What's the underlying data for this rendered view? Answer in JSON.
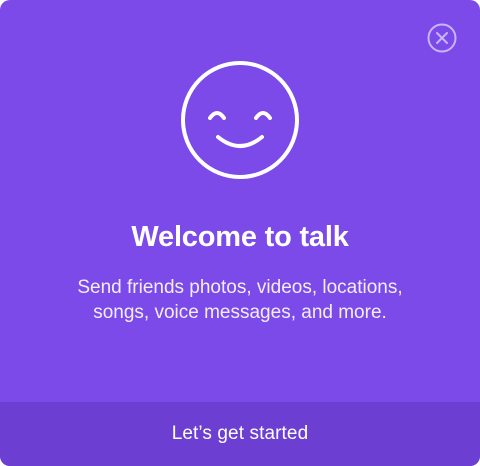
{
  "dialog": {
    "title": "Welcome to talk",
    "description": "Send friends photos, videos, locations, songs, voice messages, and more.",
    "primary_action_label": "Let’s get started",
    "close_icon": "close-circle-icon",
    "hero_icon": "smiley-face-icon"
  },
  "colors": {
    "background": "#7b4ae8",
    "footer_background": "#6c3ed2",
    "close_icon": "#c9b4ff",
    "text": "#ffffff"
  }
}
